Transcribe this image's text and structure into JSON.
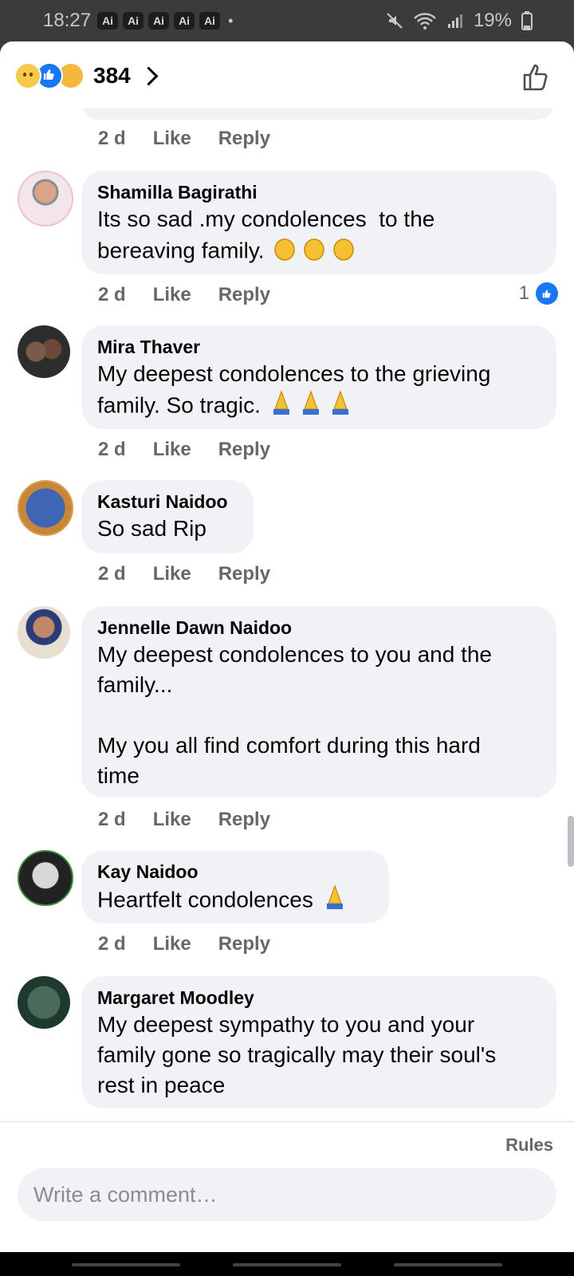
{
  "status_bar": {
    "time": "18:27",
    "ai_badges": [
      "Ai",
      "Ai",
      "Ai",
      "Ai",
      "Ai"
    ],
    "battery": "19%"
  },
  "header": {
    "reaction_count": "384",
    "reaction_icons": [
      "sad-reaction-icon",
      "like-reaction-icon",
      "care-reaction-icon"
    ]
  },
  "actions": {
    "like": "Like",
    "reply": "Reply"
  },
  "previous_comment": {
    "time": "2 d"
  },
  "comments": [
    {
      "author": "Shamilla Bagirathi",
      "text": "Its so sad .my condolences  to the\nbereaving family.",
      "emoji": "clapping-hands",
      "time": "2 d",
      "likes": "1"
    },
    {
      "author": "Mira Thaver",
      "text": "My deepest condolences to the grieving\nfamily. So tragic.",
      "emoji": "folded-hands",
      "time": "2 d"
    },
    {
      "author": "Kasturi Naidoo",
      "text": "So sad Rip",
      "time": "2 d"
    },
    {
      "author": "Jennelle Dawn Naidoo",
      "text": "My deepest condolences to you and the\nfamily...\n\nMy you all find comfort during this hard\ntime",
      "time": "2 d"
    },
    {
      "author": "Kay Naidoo",
      "text": "Heartfelt condolences",
      "emoji": "folded-hands",
      "time": "2 d"
    },
    {
      "author": "Margaret Moodley",
      "text": "My deepest sympathy to you and your\nfamily gone so tragically may their soul's\nrest in peace"
    }
  ],
  "footer": {
    "rules": "Rules",
    "placeholder": "Write a comment…"
  },
  "colors": {
    "accent": "#1877f2",
    "bubble": "#f0f2f5",
    "muted": "#65676b"
  }
}
